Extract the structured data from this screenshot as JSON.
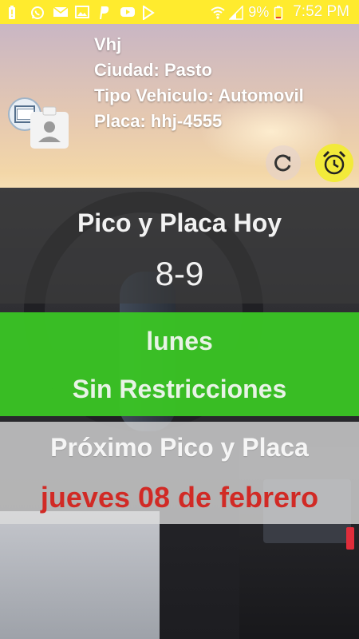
{
  "status_bar": {
    "battery_percent": "9%",
    "time": "7:52 PM",
    "left_icons": [
      "battery-alert-icon",
      "whatsapp-icon",
      "mail-icon",
      "image-icon",
      "paypal-icon",
      "youtube-icon",
      "play-store-icon"
    ],
    "right_icons": [
      "wifi-icon",
      "signal-icon"
    ]
  },
  "profile": {
    "name": "Vhj",
    "city": "Ciudad: Pasto",
    "vehicle_type": "Tipo Vehiculo: Automovil",
    "plate": "Placa: hhj-4555"
  },
  "today": {
    "title": "Pico y Placa Hoy",
    "digits": "8-9"
  },
  "current_day": {
    "day": "lunes",
    "status": "Sin Restricciones",
    "color": "#3ac724"
  },
  "next": {
    "title": "Próximo Pico y Placa",
    "date": "jueves 08 de febrero",
    "color": "#d12a25"
  },
  "colors": {
    "status_bar": "#ffeb2e",
    "alarm_button": "#f2ea3a"
  }
}
